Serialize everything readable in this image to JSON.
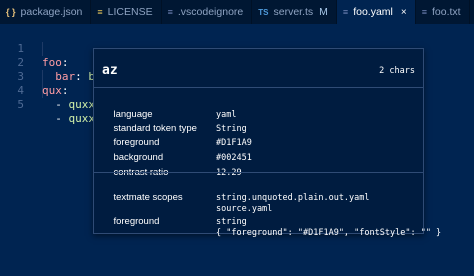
{
  "tabs": [
    {
      "icon": "{ }",
      "label": "package.json",
      "modified": "",
      "close": ""
    },
    {
      "icon": "≡",
      "label": "LICENSE",
      "modified": "",
      "close": ""
    },
    {
      "icon": "≡",
      "label": ".vscodeignore",
      "modified": "",
      "close": ""
    },
    {
      "icon": "TS",
      "label": "server.ts",
      "modified": "M",
      "close": ""
    },
    {
      "icon": "≡",
      "label": "foo.yaml",
      "modified": "",
      "close": "×"
    },
    {
      "icon": "≡",
      "label": "foo.txt",
      "modified": "",
      "close": ""
    }
  ],
  "editor": {
    "line_numbers": [
      "1",
      "2",
      "3",
      "4",
      "5"
    ],
    "line1_key": "foo",
    "line1_colon": ":",
    "line2_key": "bar",
    "line2_colon": ":",
    "line2_val_pre": "b",
    "line2_val_sel": "az",
    "line3_key": "qux",
    "line3_colon": ":",
    "line4_dash": "- ",
    "line4_val": "quxx",
    "line5_dash": "- ",
    "line5_val": "quxxx"
  },
  "hover": {
    "token": "az",
    "chars": "2 chars",
    "rows": [
      {
        "label": "language",
        "value": "yaml"
      },
      {
        "label": "standard token type",
        "value": "String"
      },
      {
        "label": "foreground",
        "value": "#D1F1A9"
      },
      {
        "label": "background",
        "value": "#002451"
      },
      {
        "label": "contrast ratio",
        "value": "12.29"
      }
    ],
    "scopes_label": "textmate scopes",
    "scopes": [
      "string.unquoted.plain.out.yaml",
      "source.yaml"
    ],
    "fg_label": "foreground",
    "fg_values": [
      "string",
      "{ \"foreground\": \"#D1F1A9\", \"fontStyle\": \"\" }"
    ]
  },
  "colors": {
    "background": "#002451",
    "string": "#D1F1A9",
    "key": "#FF9DA4"
  }
}
